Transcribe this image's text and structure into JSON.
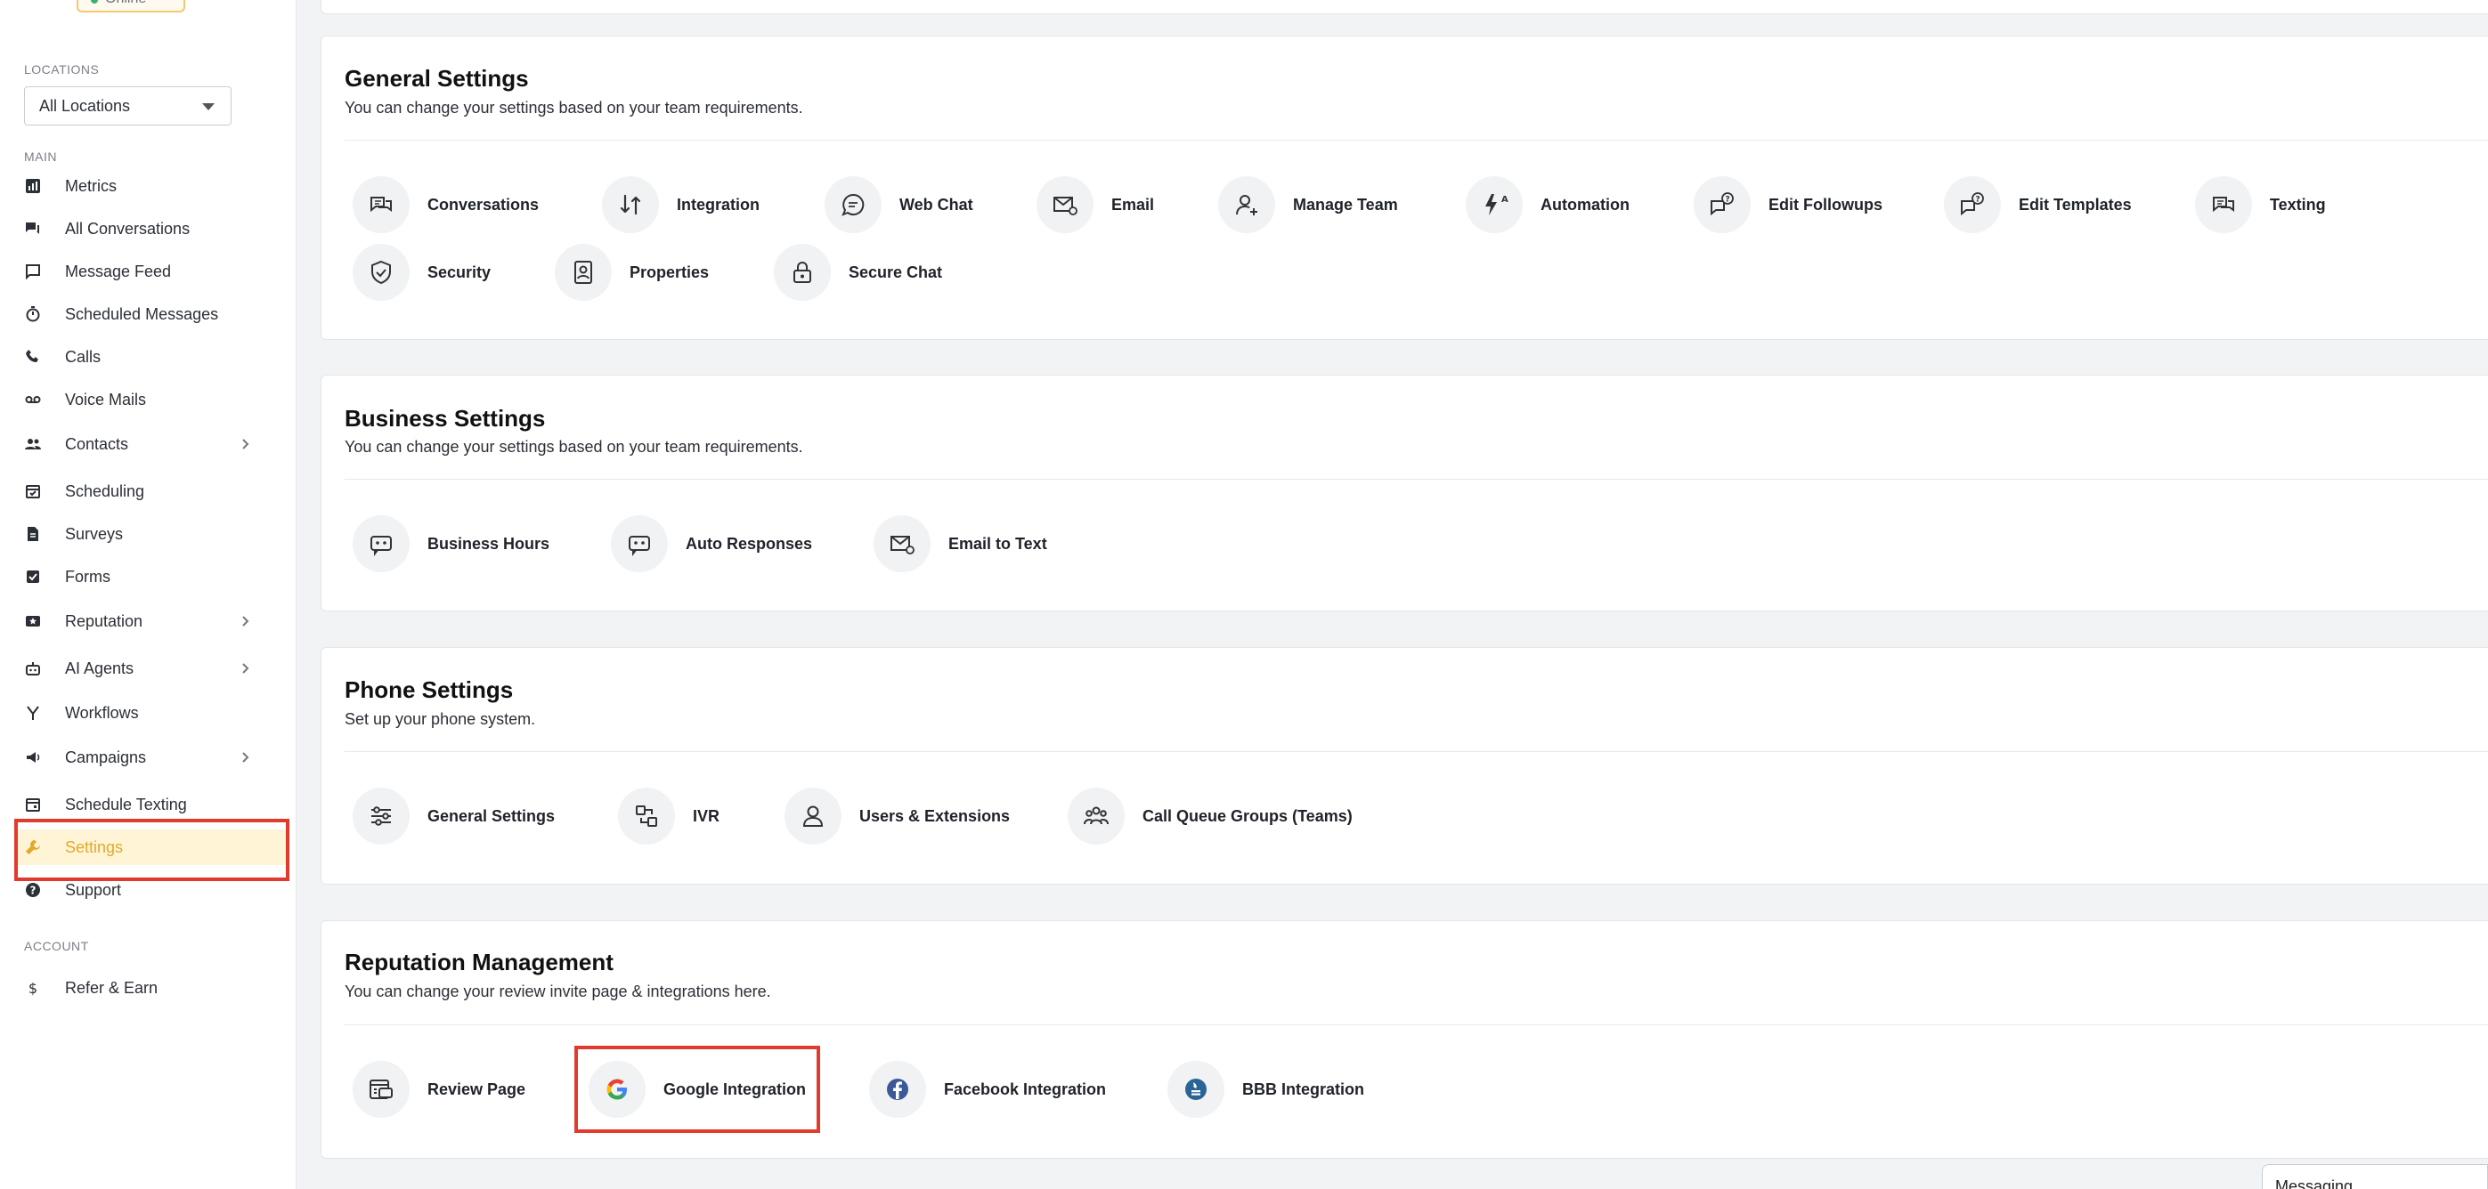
{
  "sidebar": {
    "status": "Online",
    "locations_label": "LOCATIONS",
    "location_value": "All Locations",
    "main_label": "MAIN",
    "account_label": "ACCOUNT",
    "items": [
      {
        "label": "Metrics",
        "icon": "metrics-icon"
      },
      {
        "label": "All Conversations",
        "icon": "conversations-icon"
      },
      {
        "label": "Message Feed",
        "icon": "message-feed-icon"
      },
      {
        "label": "Scheduled Messages",
        "icon": "timer-icon"
      },
      {
        "label": "Calls",
        "icon": "phone-icon"
      },
      {
        "label": "Voice Mails",
        "icon": "voicemail-icon"
      },
      {
        "label": "Contacts",
        "icon": "contacts-icon"
      },
      {
        "label": "Scheduling",
        "icon": "calendar-check-icon"
      },
      {
        "label": "Surveys",
        "icon": "document-icon"
      },
      {
        "label": "Forms",
        "icon": "form-check-icon"
      },
      {
        "label": "Reputation",
        "icon": "reputation-icon"
      },
      {
        "label": "AI Agents",
        "icon": "robot-icon"
      },
      {
        "label": "Workflows",
        "icon": "workflow-icon"
      },
      {
        "label": "Campaigns",
        "icon": "megaphone-icon"
      },
      {
        "label": "Schedule Texting",
        "icon": "calendar-icon"
      },
      {
        "label": "Settings",
        "icon": "wrench-icon"
      },
      {
        "label": "Support",
        "icon": "help-icon"
      }
    ],
    "account_items": [
      {
        "label": "Refer & Earn",
        "icon": "dollar-icon"
      }
    ]
  },
  "sections": {
    "general": {
      "title": "General Settings",
      "subtitle": "You can change your settings based on your team requirements.",
      "tiles": [
        "Conversations",
        "Integration",
        "Web Chat",
        "Email",
        "Manage Team",
        "Automation",
        "Edit Followups",
        "Edit Templates",
        "Texting",
        "Security",
        "Properties",
        "Secure Chat"
      ]
    },
    "business": {
      "title": "Business Settings",
      "subtitle": "You can change your settings based on your team requirements.",
      "tiles": [
        "Business Hours",
        "Auto Responses",
        "Email to Text"
      ]
    },
    "phone": {
      "title": "Phone Settings",
      "subtitle": "Set up your phone system.",
      "tiles": [
        "General Settings",
        "IVR",
        "Users & Extensions",
        "Call Queue Groups (Teams)"
      ]
    },
    "reputation": {
      "title": "Reputation Management",
      "subtitle": "You can change your review invite page & integrations here.",
      "tiles": [
        "Review Page",
        "Google Integration",
        "Facebook Integration",
        "BBB Integration"
      ]
    }
  },
  "messaging_tab": "Messaging",
  "colors": {
    "accent": "#e3a92a",
    "active_bg": "#fff5d6",
    "highlight": "#e13b2e",
    "facebook": "#3b5998",
    "bbb": "#2a6496"
  }
}
